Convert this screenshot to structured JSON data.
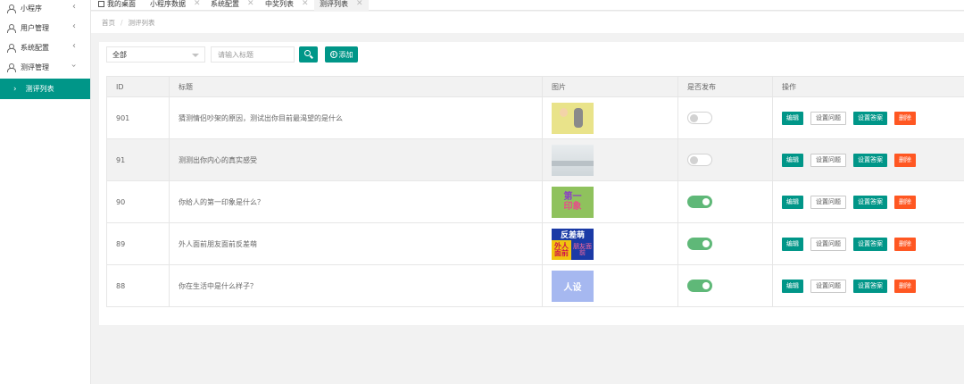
{
  "sidebar": {
    "items": [
      {
        "label": "小程序"
      },
      {
        "label": "用户管理"
      },
      {
        "label": "系统配置"
      },
      {
        "label": "测评管理"
      }
    ],
    "active_item": "测评列表"
  },
  "tabs": [
    {
      "label": "我的桌面"
    },
    {
      "label": "小程序数据"
    },
    {
      "label": "系统配置"
    },
    {
      "label": "中奖列表"
    },
    {
      "label": "测评列表"
    }
  ],
  "breadcrumb": {
    "home": "首页",
    "separator": "/",
    "current": "测评列表"
  },
  "toolbar": {
    "select_value": "全部",
    "search_placeholder": "请输入标题",
    "add_label": "添加"
  },
  "table": {
    "headers": [
      "ID",
      "标题",
      "图片",
      "是否发布",
      "操作"
    ],
    "rows": [
      {
        "id": "901",
        "title": "猜测情侣吵架的原因，测试出你目前最渴望的是什么",
        "published": false
      },
      {
        "id": "91",
        "title": "测测出你内心的真实感受",
        "published": false
      },
      {
        "id": "90",
        "title": "你给人的第一印象是什么？",
        "published": true
      },
      {
        "id": "89",
        "title": "外人面前朋友面前反差萌",
        "published": true
      },
      {
        "id": "88",
        "title": "你在生活中是什么样子？",
        "published": true
      }
    ],
    "actions": {
      "edit": "编辑",
      "question": "设置问题",
      "answer": "设置答案",
      "delete": "删除"
    }
  },
  "thumbs": {
    "t2": [
      "第一",
      "印象"
    ],
    "t3": {
      "top": "反差萌",
      "left": "外人面前",
      "right": "朋友面前"
    },
    "t4": "人设"
  },
  "colors": {
    "accent": "#009688",
    "danger": "#ff5722",
    "switch_on": "#5fb878"
  }
}
